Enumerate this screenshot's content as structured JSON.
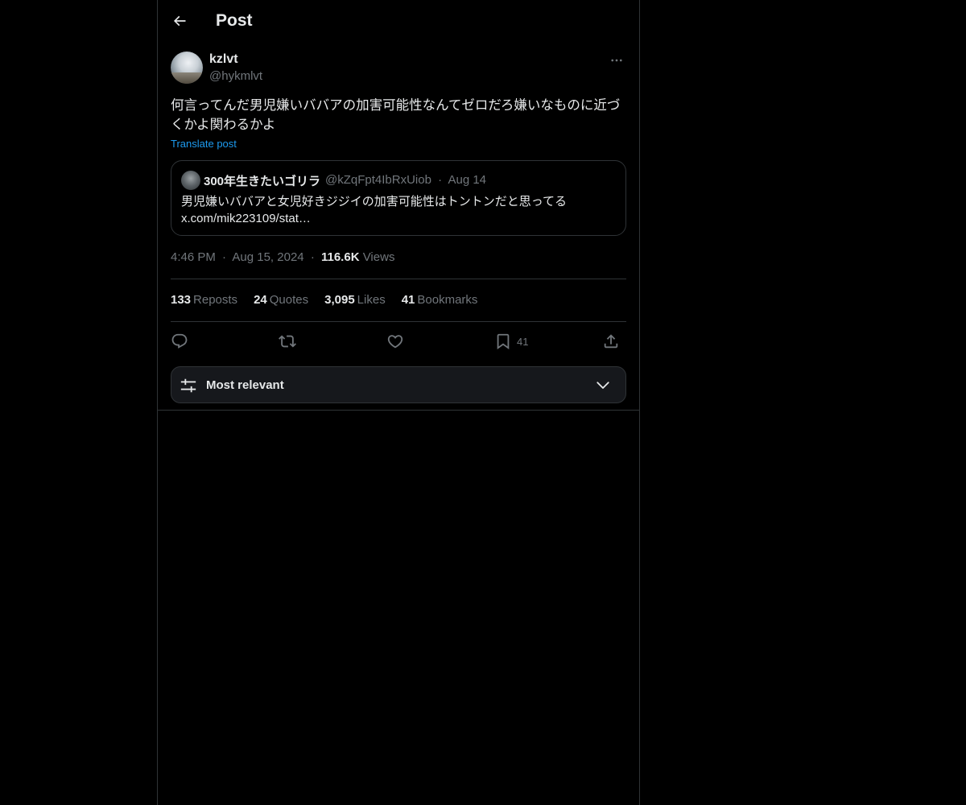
{
  "header": {
    "title": "Post",
    "back_icon": "arrow-left-icon"
  },
  "post": {
    "author": {
      "display_name": "kzlvt",
      "handle": "@hykmlvt"
    },
    "text": "何言ってんだ男児嫌いババアの加害可能性なんてゼロだろ嫌いなものに近づくかよ関わるかよ",
    "translate_label": "Translate post",
    "quote": {
      "display_name": "300年生きたいゴリラ",
      "handle": "@kZqFpt4IbRxUiob",
      "separator": "·",
      "date": "Aug 14",
      "text_line1": "男児嫌いババアと女児好きジジイの加害可能性はトントンだと思ってる",
      "text_line2": "x.com/mik223109/stat…"
    },
    "time": "4:46 PM",
    "date": "Aug 15, 2024",
    "separator": "·",
    "views_count": "116.6K",
    "views_label": "Views"
  },
  "stats": [
    {
      "count": "133",
      "label": "Reposts"
    },
    {
      "count": "24",
      "label": "Quotes"
    },
    {
      "count": "3,095",
      "label": "Likes"
    },
    {
      "count": "41",
      "label": "Bookmarks"
    }
  ],
  "actions": {
    "reply_icon": "reply-icon",
    "repost_icon": "repost-icon",
    "like_icon": "heart-icon",
    "bookmark_icon": "bookmark-icon",
    "bookmark_count": "41",
    "share_icon": "share-icon"
  },
  "sort": {
    "label": "Most relevant",
    "icon": "sliders-icon",
    "chevron": "chevron-down-icon"
  },
  "colors": {
    "background": "#000000",
    "text": "#e7e9ea",
    "muted": "#71767b",
    "link": "#1d9bf0",
    "border": "#2f3336"
  }
}
